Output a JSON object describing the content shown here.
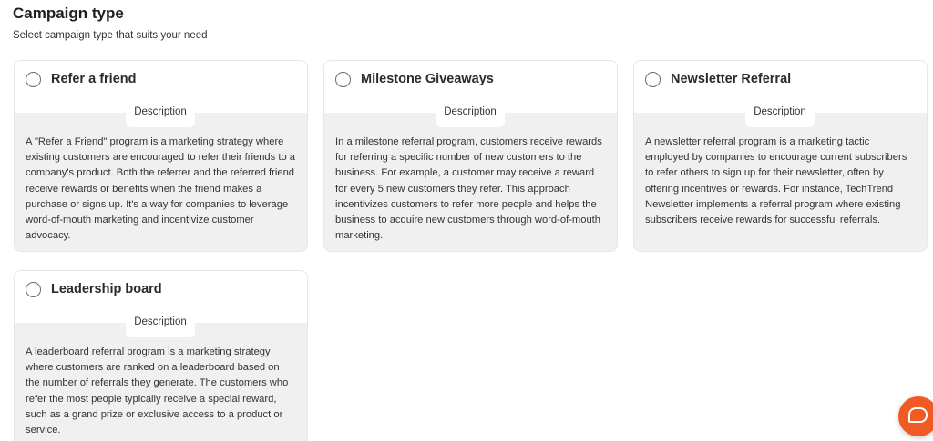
{
  "header": {
    "title": "Campaign type",
    "subtitle": "Select campaign type that suits your need"
  },
  "cards": [
    {
      "title": "Refer a friend",
      "tag": "Description",
      "description": "A \"Refer a Friend\" program is a marketing strategy where existing customers are encouraged to refer their friends to a company's product. Both the referrer and the referred friend receive rewards or benefits when the friend makes a purchase or signs up. It's a way for companies to leverage word-of-mouth marketing and incentivize customer advocacy."
    },
    {
      "title": "Milestone Giveaways",
      "tag": "Description",
      "description": "In a milestone referral program, customers receive rewards for referring a specific number of new customers to the business. For example, a customer may receive a reward for every 5 new customers they refer. This approach incentivizes customers to refer more people and helps the business to acquire new customers through word-of-mouth marketing."
    },
    {
      "title": "Newsletter Referral",
      "tag": "Description",
      "description": "A newsletter referral program is a marketing tactic employed by companies to encourage current subscribers to refer others to sign up for their newsletter, often by offering incentives or rewards. For instance, TechTrend Newsletter implements a referral program where existing subscribers receive rewards for successful referrals."
    },
    {
      "title": "Leadership board",
      "tag": "Description",
      "description": "A leaderboard referral program is a marketing strategy where customers are ranked on a leaderboard based on the number of referrals they generate. The customers who refer the most people typically receive a special reward, such as a grand prize or exclusive access to a product or service."
    }
  ],
  "chat": {
    "icon": "chat-bubble-icon",
    "color": "#f15a22"
  }
}
